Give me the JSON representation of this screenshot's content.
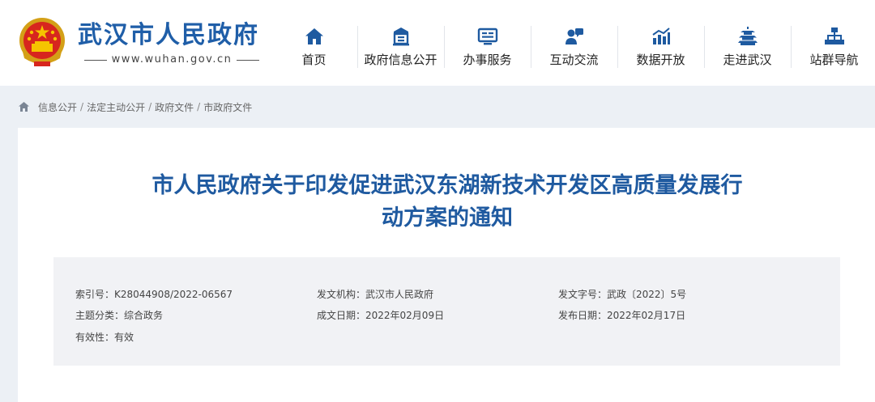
{
  "header": {
    "site_name": "武汉市人民政府",
    "site_url": "www.wuhan.gov.cn"
  },
  "nav": {
    "items": [
      {
        "label": "首页",
        "icon": "home-icon"
      },
      {
        "label": "政府信息公开",
        "icon": "building-icon"
      },
      {
        "label": "办事服务",
        "icon": "service-window-icon"
      },
      {
        "label": "互动交流",
        "icon": "interaction-icon"
      },
      {
        "label": "数据开放",
        "icon": "bar-chart-icon"
      },
      {
        "label": "走进武汉",
        "icon": "yellow-crane-tower-icon"
      },
      {
        "label": "站群导航",
        "icon": "sitemap-icon"
      }
    ]
  },
  "breadcrumb": {
    "items": [
      "信息公开",
      "法定主动公开",
      "政府文件",
      "市政府文件"
    ],
    "separator": "/"
  },
  "document": {
    "title_line1": "市人民政府关于印发促进武汉东湖新技术开发区高质量发展行",
    "title_line2": "动方案的通知",
    "meta": {
      "index_no": "索引号：K28044908/2022-06567",
      "issuer": "发文机构：武汉市人民政府",
      "doc_no": "发文字号：武政〔2022〕5号",
      "category": "主题分类：综合政务",
      "written_date": "成文日期：2022年02月09日",
      "publish_date": "发布日期：2022年02月17日",
      "validity": "有效性：有效"
    }
  },
  "colors": {
    "brand_blue": "#1f5ea8",
    "title_blue": "#1f5aa0",
    "nav_icon": "#1e5aa0",
    "page_bg": "#ecf0f5",
    "meta_bg": "#f1f2f5"
  }
}
